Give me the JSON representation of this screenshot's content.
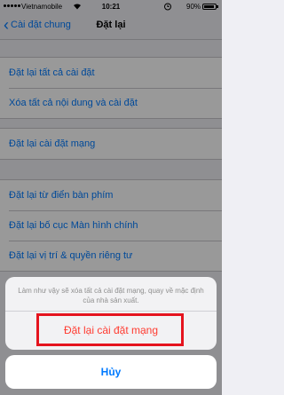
{
  "status_bar": {
    "carrier": "Vietnamobile",
    "time": "10:21",
    "battery_percent": "90%",
    "battery_level": 0.9
  },
  "nav": {
    "back_label": "Cài đặt chung",
    "title": "Đặt lại"
  },
  "groups": [
    {
      "items": [
        "Đặt lại tất cả cài đặt",
        "Xóa tất cả nội dung và cài đặt"
      ]
    },
    {
      "items": [
        "Đặt lại cài đặt mạng"
      ]
    },
    {
      "items": [
        "Đặt lại từ điển bàn phím",
        "Đặt lại bố cục Màn hình chính",
        "Đặt lại vị trí & quyền riêng tư"
      ]
    }
  ],
  "action_sheet": {
    "message": "Làm như vậy sẽ xóa tất cả cài đặt mạng, quay về mặc định của nhà sản xuất.",
    "destructive_label": "Đặt lại cài đặt mạng",
    "cancel_label": "Hủy"
  },
  "colors": {
    "link_blue": "#007aff",
    "destructive_red": "#ff3b30",
    "highlight_red": "#e5141e"
  }
}
